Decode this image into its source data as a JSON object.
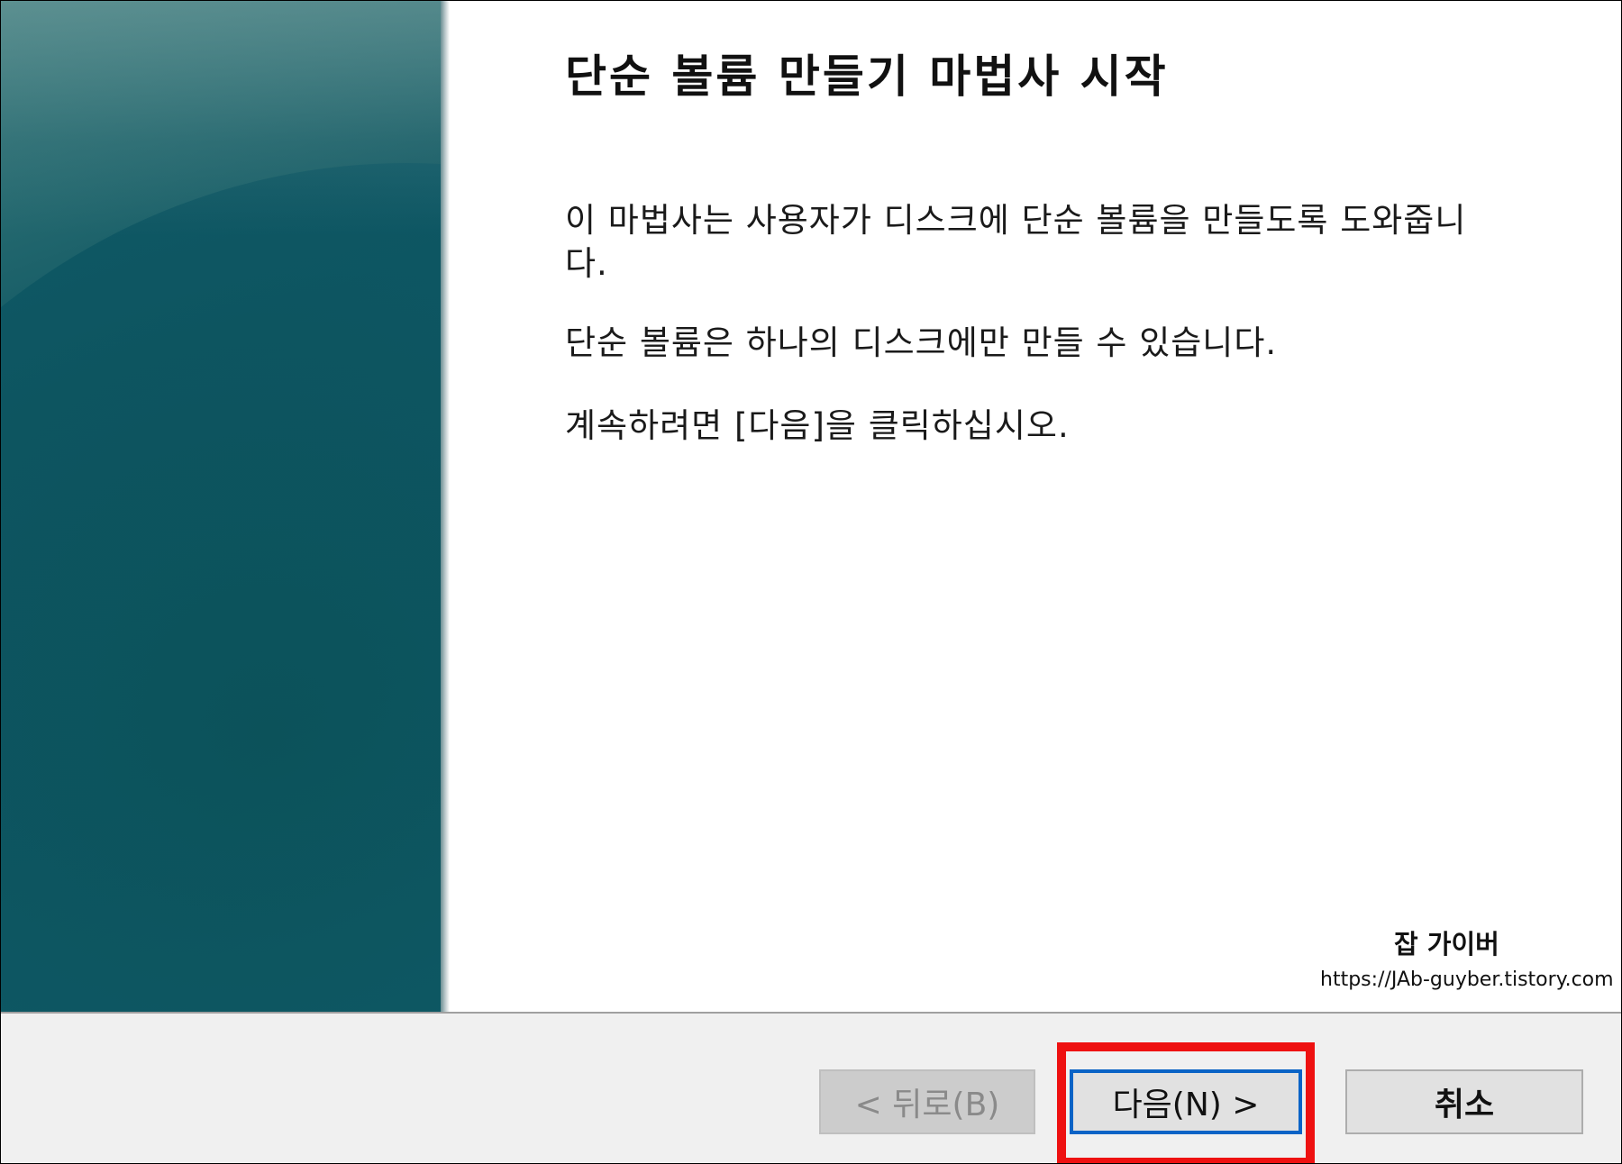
{
  "wizard": {
    "title": "단순 볼륨 만들기 마법사 시작",
    "description_1": "이 마법사는 사용자가 디스크에 단순 볼륨을 만들도록 도와줍니다.",
    "description_2": "단순 볼륨은 하나의 디스크에만 만들 수 있습니다.",
    "description_3": "계속하려면 [다음]을 클릭하십시오."
  },
  "watermark": {
    "name": "잡 가이버",
    "url": "https://JAb-guyber.tistory.com"
  },
  "buttons": {
    "back_label": "< 뒤로(B)",
    "next_label": "다음(N) >",
    "cancel_label": "취소"
  },
  "colors": {
    "side_panel": "#0f5661",
    "highlight": "#ee1111",
    "focus_border": "#0a63c6"
  }
}
